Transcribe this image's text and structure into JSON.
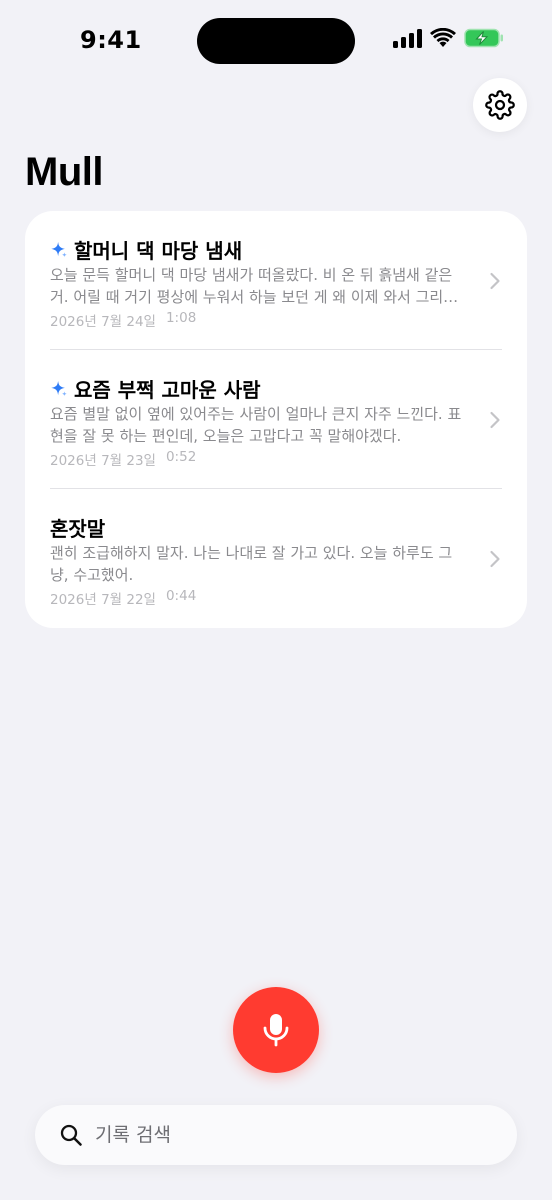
{
  "status_bar": {
    "time": "9:41"
  },
  "app": {
    "title": "Mull"
  },
  "entries": [
    {
      "title": "할머니 댁 마당 냄새",
      "ai_generated": true,
      "preview": "오늘 문득 할머니 댁 마당 냄새가 떠올랐다. 비 온 뒤 흙냄새 같은 거. 어릴 때 거기 평상에 누워서 하늘 보던 게 왜 이제 와서 그리…",
      "date": "2026년 7월 24일",
      "duration": "1:08"
    },
    {
      "title": "요즘 부쩍 고마운 사람",
      "ai_generated": true,
      "preview": "요즘 별말 없이 옆에 있어주는 사람이 얼마나 큰지 자주 느낀다. 표현을 잘 못 하는 편인데, 오늘은 고맙다고 꼭 말해야겠다.",
      "date": "2026년 7월 23일",
      "duration": "0:52"
    },
    {
      "title": "혼잣말",
      "ai_generated": false,
      "preview": "괜히 조급해하지 말자. 나는 나대로 잘 가고 있다. 오늘 하루도 그냥, 수고했어.",
      "date": "2026년 7월 22일",
      "duration": "0:44"
    }
  ],
  "search": {
    "placeholder": "기록 검색",
    "value": ""
  },
  "icons": {
    "settings": "gear-icon",
    "sparkle": "sparkle-icon",
    "chevron": "chevron-right-icon",
    "mic": "microphone-icon",
    "search": "search-icon"
  },
  "colors": {
    "background": "#f2f2f7",
    "record_button": "#ff3b30",
    "sparkle": "#2f7cf6",
    "battery": "#34c759"
  }
}
